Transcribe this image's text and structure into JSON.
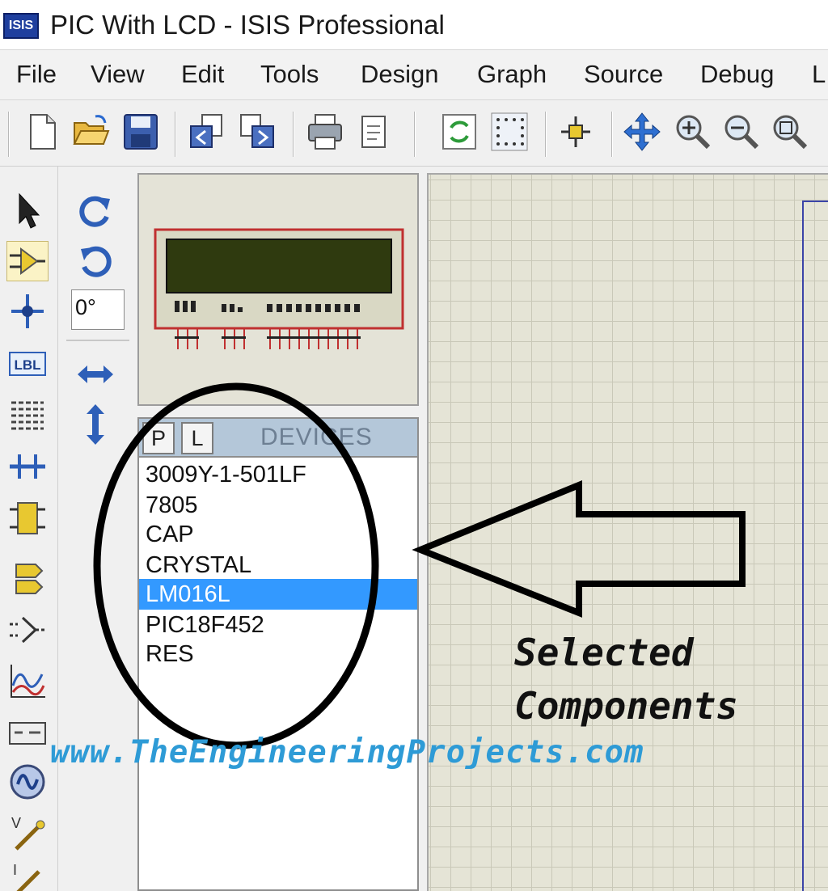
{
  "window": {
    "app_logo": "ISIS",
    "title": "PIC With LCD - ISIS Professional"
  },
  "menu": [
    "File",
    "View",
    "Edit",
    "Tools",
    "Design",
    "Graph",
    "Source",
    "Debug",
    "L"
  ],
  "toolbar": {
    "icons": [
      "new-file-icon",
      "open-folder-icon",
      "save-icon",
      "import-icon",
      "export-icon",
      "print-icon",
      "page-setup-icon",
      "refresh-icon",
      "grid-icon",
      "origin-icon",
      "pan-icon",
      "zoom-in-icon",
      "zoom-out-icon",
      "zoom-all-icon"
    ]
  },
  "mode_toolbar": {
    "icons": [
      "selection-arrow-icon",
      "component-mode-icon",
      "junction-dot-icon",
      "wire-label-icon",
      "text-script-icon",
      "bus-icon",
      "subcircuit-icon",
      "terminal-icon",
      "device-pin-icon",
      "graph-icon",
      "tape-recorder-icon",
      "generator-icon",
      "voltage-probe-icon",
      "current-probe-icon"
    ],
    "wire_label_text": "LBL"
  },
  "orientation": {
    "angle_value": "0°",
    "icons": [
      "rotate-clockwise-icon",
      "rotate-anticlockwise-icon",
      "mirror-horizontal-icon",
      "mirror-vertical-icon"
    ]
  },
  "device_panel": {
    "pick_button": "P",
    "library_button": "L",
    "title": "DEVICES",
    "devices": [
      "3009Y-1-501LF",
      "7805",
      "CAP",
      "CRYSTAL",
      "LM016L",
      "PIC18F452",
      "RES"
    ],
    "selected": "LM016L"
  },
  "annotation": {
    "line1": "Selected",
    "line2": "Components",
    "watermark": "www.TheEngineeringProjects.com"
  },
  "colors": {
    "selection": "#3399ff",
    "canvas": "#e5e4d6",
    "lcd_screen": "#2f3a0f",
    "watermark": "#2e9bd6"
  }
}
